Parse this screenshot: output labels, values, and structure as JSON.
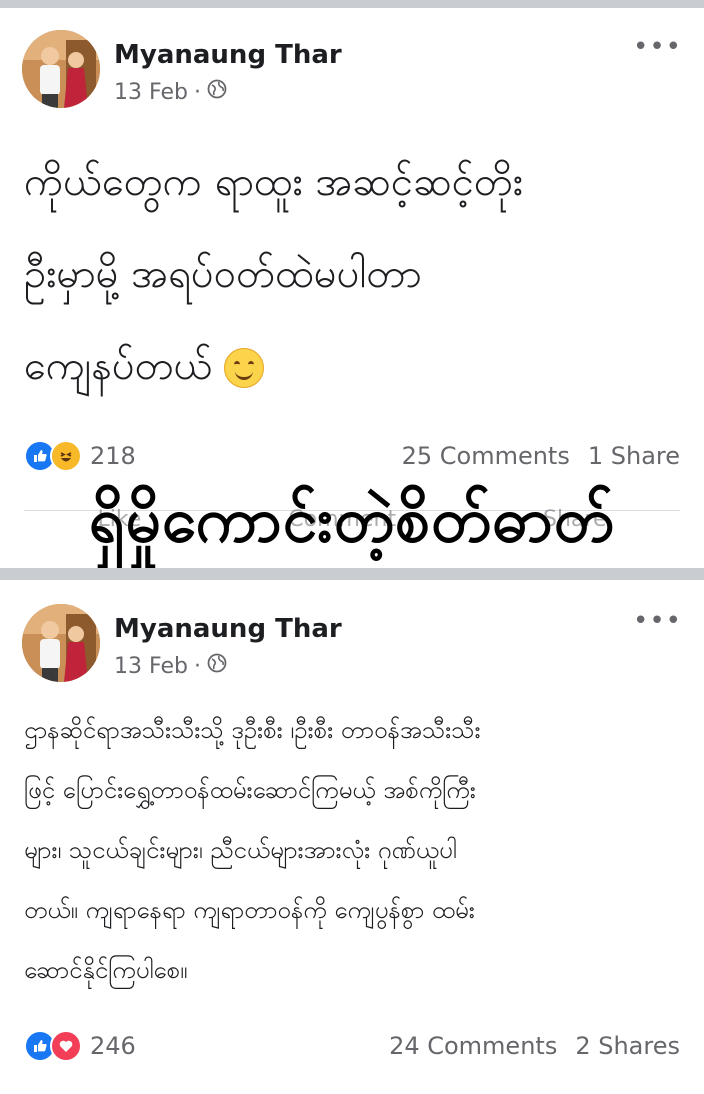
{
  "posts": [
    {
      "author": "Myanaung Thar",
      "date": "13 Feb",
      "audience_icon": "globe-icon",
      "more": "•••",
      "text_lines": [
        "ကိုယ်တွေက ရာထူး အဆင့်ဆင့်တိုး",
        "ဦးမှာမို့ အရပ်ဝတ်ထဲမပါတာ",
        "ကျေနပ်တယ်"
      ],
      "emoji": "smiling-face-icon",
      "reactions": [
        "like",
        "haha"
      ],
      "reaction_count": "218",
      "comments": "25 Comments",
      "shares": "1 Share",
      "actions": [
        "Like",
        "Comment",
        "Share"
      ]
    },
    {
      "author": "Myanaung Thar",
      "date": "13 Feb",
      "audience_icon": "globe-icon",
      "more": "•••",
      "text_lines": [
        "ဌာနဆိုင်ရာအသီးသီးသို့ ဒုဦးစီး ၊ဦးစီး တာဝန်အသီးသီး",
        "ဖြင့် ပြောင်းရွှေ့တာဝန်ထမ်းဆောင်ကြမယ့် အစ်ကိုကြီး",
        "များ၊ သူငယ်ချင်းများ၊ ညီငယ်များအားလုံး ဂုဏ်ယူပါ",
        "တယ်။ ကျရာနေရာ ကျရာတာဝန်ကို ကျေပွန်စွာ ထမ်း",
        "ဆောင်နိုင်ကြပါစေ။"
      ],
      "reactions": [
        "like",
        "love"
      ],
      "reaction_count": "246",
      "comments": "24 Comments",
      "shares": "2 Shares"
    }
  ],
  "overlay_caption": "ရှိမှိုကောင်းတဲ့စိတ်ဓာတ်",
  "colors": {
    "like": "#1877f2",
    "haha": "#f7b928",
    "love": "#f33e58",
    "divider": "#c9ccd1",
    "meta": "#65676b"
  }
}
